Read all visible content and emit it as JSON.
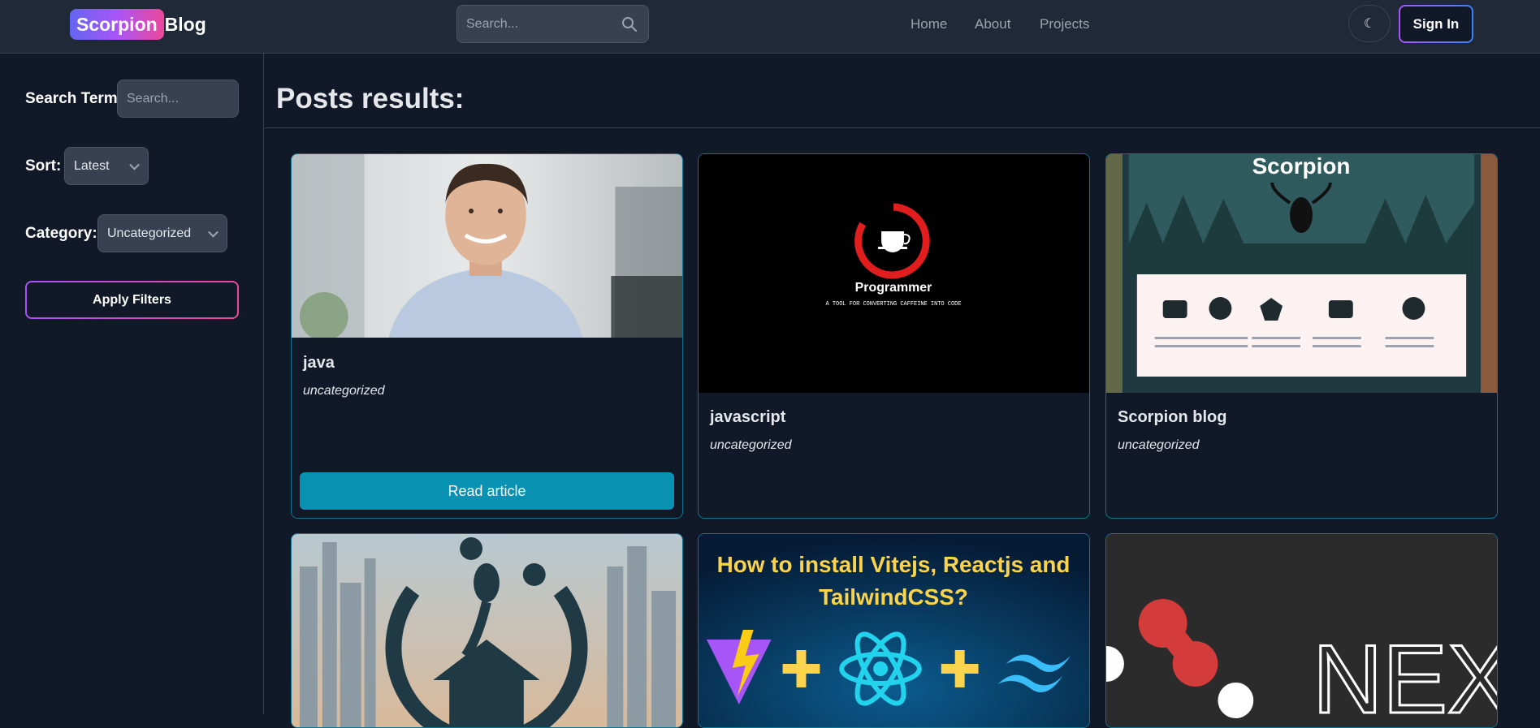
{
  "header": {
    "logo_highlight": "Scorpion",
    "logo_rest": "Blog",
    "search_placeholder": "Search...",
    "nav": [
      "Home",
      "About",
      "Projects"
    ],
    "theme_icon": "moon-icon",
    "signin_label": "Sign In"
  },
  "sidebar": {
    "search_label": "Search Term:",
    "search_placeholder": "Search...",
    "sort_label": "Sort:",
    "sort_value": "Latest",
    "category_label": "Category:",
    "category_value": "Uncategorized",
    "apply_label": "Apply Filters"
  },
  "main": {
    "title": "Posts results:",
    "posts": [
      {
        "title": "java",
        "category": "uncategorized",
        "button": "Read article",
        "image": "smiling man portrait"
      },
      {
        "title": "javascript",
        "category": "uncategorized",
        "image": "programmer coffee logo"
      },
      {
        "title": "Scorpion blog",
        "category": "uncategorized",
        "image": "scorpion blog website mockup"
      },
      {
        "title": "",
        "category": "",
        "image": "scorpion house logo over city"
      },
      {
        "title": "",
        "category": "",
        "image": "vite react tailwind banner"
      },
      {
        "title": "",
        "category": "",
        "image": "nextjs logo"
      }
    ],
    "thumb_text": {
      "programmer_title": "Programmer",
      "programmer_tagline": "A TOOL FOR CONVERTING CAFFEINE INTO CODE",
      "scorpion_title": "Scorpion",
      "vite_line1": "How to install Vitejs, Reactjs and",
      "vite_line2": "TailwindCSS?",
      "next_logo": "NEXT"
    }
  },
  "colors": {
    "background": "#111827",
    "header": "#1f2937",
    "accent_cyan": "#0891b2",
    "card_border": "#0e7490",
    "brand_gradient": [
      "#6366f1",
      "#a855f7",
      "#ec4899"
    ]
  }
}
